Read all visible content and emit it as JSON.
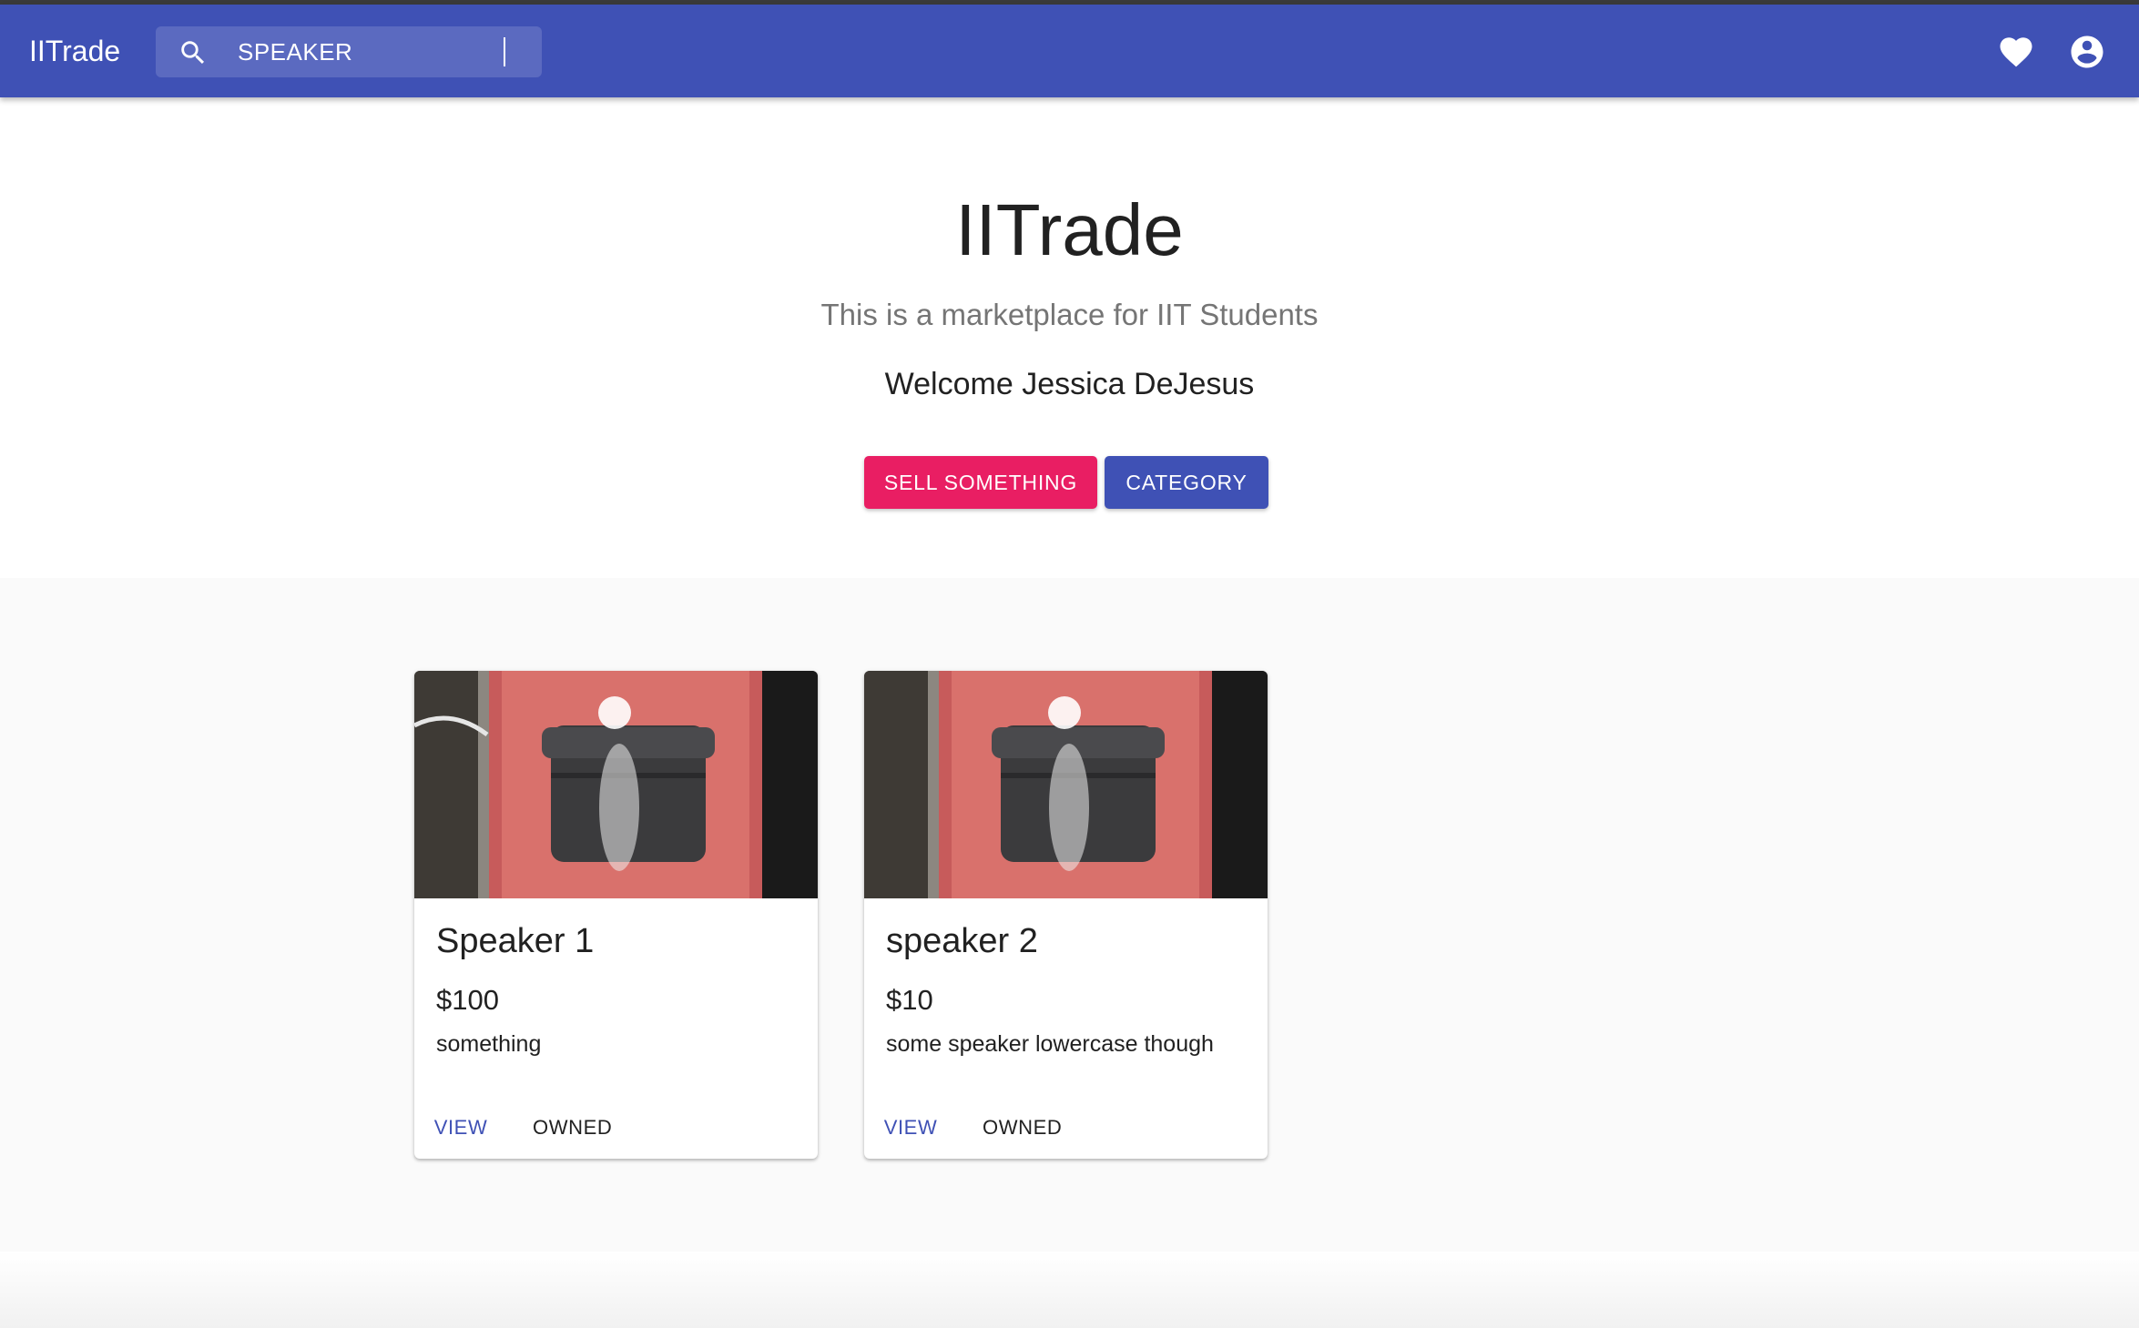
{
  "appbar": {
    "brand": "IITrade",
    "search": {
      "value": "SPEAKER",
      "icon": "search-icon"
    },
    "icons": [
      "heart-icon",
      "account-circle-icon"
    ],
    "color": "#3f51b5"
  },
  "hero": {
    "title": "IITrade",
    "subtitle": "This is a marketplace for IIT Students",
    "welcome": "Welcome Jessica DeJesus",
    "sell_button": "SELL SOMETHING",
    "category_button": "CATEGORY",
    "sell_color": "#e91e63",
    "category_color": "#3f51b5"
  },
  "listings": [
    {
      "title": "Speaker 1",
      "price": "$100",
      "description": "something",
      "view_label": "VIEW",
      "owned_label": "OWNED"
    },
    {
      "title": "speaker 2",
      "price": "$10",
      "description": "some speaker lowercase though",
      "view_label": "VIEW",
      "owned_label": "OWNED"
    }
  ]
}
